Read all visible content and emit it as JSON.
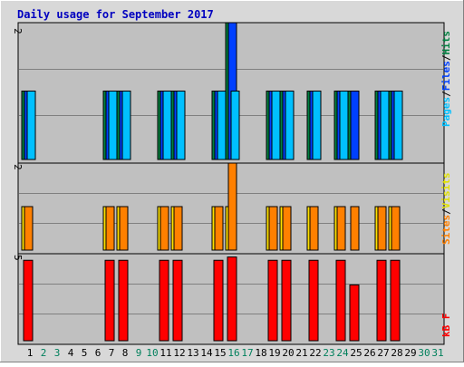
{
  "chart_data": [
    {
      "type": "bar",
      "panel": "hits",
      "title": "Daily usage for September 2017",
      "categories": [
        "1",
        "2",
        "3",
        "4",
        "5",
        "6",
        "7",
        "8",
        "9",
        "10",
        "11",
        "12",
        "13",
        "14",
        "15",
        "16",
        "17",
        "18",
        "19",
        "20",
        "21",
        "22",
        "23",
        "24",
        "25",
        "26",
        "27",
        "28",
        "29",
        "30",
        "31"
      ],
      "ymax_label": "2",
      "ylim": [
        0,
        2
      ],
      "series": [
        {
          "name": "Hits",
          "color": "#008040",
          "values": [
            1,
            0,
            0,
            0,
            0,
            0,
            1,
            1,
            0,
            0,
            1,
            1,
            0,
            0,
            1,
            2,
            0,
            0,
            1,
            1,
            0,
            1,
            0,
            1,
            1,
            0,
            1,
            1,
            0,
            0,
            0
          ]
        },
        {
          "name": "Files",
          "color": "#0040ff",
          "values": [
            1,
            0,
            0,
            0,
            0,
            0,
            1,
            1,
            0,
            0,
            1,
            1,
            0,
            0,
            1,
            2,
            0,
            0,
            1,
            1,
            0,
            1,
            0,
            1,
            1,
            0,
            1,
            1,
            0,
            0,
            0
          ]
        },
        {
          "name": "Pages",
          "color": "#00c0ff",
          "values": [
            1,
            0,
            0,
            0,
            0,
            0,
            1,
            1,
            0,
            0,
            1,
            1,
            0,
            0,
            1,
            1,
            0,
            0,
            1,
            1,
            0,
            1,
            0,
            1,
            0,
            0,
            1,
            1,
            0,
            0,
            0
          ]
        }
      ],
      "legend_labels": [
        "Pages",
        "Files",
        "Hits"
      ],
      "legend_placement": "right (vertical)"
    },
    {
      "type": "bar",
      "panel": "sites",
      "categories": [
        "1",
        "2",
        "3",
        "4",
        "5",
        "6",
        "7",
        "8",
        "9",
        "10",
        "11",
        "12",
        "13",
        "14",
        "15",
        "16",
        "17",
        "18",
        "19",
        "20",
        "21",
        "22",
        "23",
        "24",
        "25",
        "26",
        "27",
        "28",
        "29",
        "30",
        "31"
      ],
      "ymax_label": "2",
      "ylim": [
        0,
        2
      ],
      "series": [
        {
          "name": "Visits",
          "color": "#ffff00",
          "values": [
            1,
            0,
            0,
            0,
            0,
            0,
            1,
            1,
            0,
            0,
            1,
            1,
            0,
            0,
            1,
            1,
            0,
            0,
            1,
            1,
            0,
            1,
            0,
            1,
            0,
            0,
            1,
            1,
            0,
            0,
            0
          ]
        },
        {
          "name": "Sites",
          "color": "#ff8000",
          "values": [
            1,
            0,
            0,
            0,
            0,
            0,
            1,
            1,
            0,
            0,
            1,
            1,
            0,
            0,
            1,
            2,
            0,
            0,
            1,
            1,
            0,
            1,
            0,
            1,
            1,
            0,
            1,
            1,
            0,
            0,
            0
          ]
        }
      ],
      "legend_labels": [
        "Sites",
        "Visits"
      ],
      "legend_placement": "right (vertical)"
    },
    {
      "type": "bar",
      "panel": "kbytes",
      "categories": [
        "1",
        "2",
        "3",
        "4",
        "5",
        "6",
        "7",
        "8",
        "9",
        "10",
        "11",
        "12",
        "13",
        "14",
        "15",
        "16",
        "17",
        "18",
        "19",
        "20",
        "21",
        "22",
        "23",
        "24",
        "25",
        "26",
        "27",
        "28",
        "29",
        "30",
        "31"
      ],
      "ymax_label": "5",
      "ylim": [
        0,
        5.3
      ],
      "series": [
        {
          "name": "KBytes",
          "color": "#ff0000",
          "values": [
            4.9,
            0,
            0,
            0,
            0,
            0,
            4.9,
            4.9,
            0,
            0,
            4.9,
            4.9,
            0,
            0,
            4.9,
            5.1,
            0,
            0,
            4.9,
            4.9,
            0,
            4.9,
            0,
            4.9,
            3.4,
            0,
            4.9,
            4.9,
            0,
            0,
            0
          ]
        }
      ],
      "legend_labels": [
        "kB F"
      ],
      "legend_placement": "right (vertical)"
    }
  ],
  "x_axis": {
    "weekend_days": [
      2,
      3,
      9,
      10,
      16,
      17,
      23,
      24,
      30,
      31
    ],
    "weekday_color": "#000000",
    "weekend_color": "#00805c"
  },
  "colors": {
    "frame_bg": "#d8d8d8",
    "plot_bg": "#c0c0c0",
    "grid": "#808080",
    "title": "#0000c0",
    "outline": "#000000"
  }
}
